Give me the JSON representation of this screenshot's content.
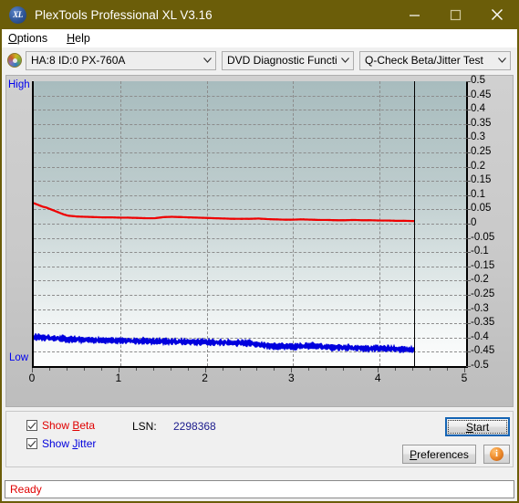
{
  "window": {
    "title": "PlexTools Professional XL V3.16",
    "icon": "xl-logo-icon",
    "minimize_label": "minimize-icon",
    "maximize_label": "maximize-icon",
    "close_label": "close-icon",
    "titlebar_color": "#6b5d09"
  },
  "menu": [
    {
      "label": "Options",
      "mnemonic": "O"
    },
    {
      "label": "Help",
      "mnemonic": "H"
    }
  ],
  "toolbar": {
    "drive_icon": "disc-icon",
    "drive_combo": {
      "value": "HA:8 ID:0  PX-760A"
    },
    "function_combo": {
      "value": "DVD Diagnostic Functions"
    },
    "test_combo": {
      "value": "Q-Check Beta/Jitter Test"
    }
  },
  "chart_data": {
    "type": "line",
    "title": "",
    "xlabel": "",
    "ylabel": "",
    "xlim": [
      0,
      5
    ],
    "ylim": [
      -0.5,
      0.5
    ],
    "grid": true,
    "legend": "below-chart",
    "axis_left_label": "High",
    "axis_bottom_left_label": "Low",
    "xticks": [
      0,
      1,
      2,
      3,
      4,
      5
    ],
    "yticks": [
      0.5,
      0.45,
      0.4,
      0.35,
      0.3,
      0.25,
      0.2,
      0.15,
      0.1,
      0.05,
      0,
      -0.05,
      -0.1,
      -0.15,
      -0.2,
      -0.25,
      -0.3,
      -0.35,
      -0.4,
      -0.45,
      -0.5
    ],
    "ytick_labels": [
      "0.5",
      "0.45",
      "0.4",
      "0.35",
      "0.3",
      "0.25",
      "0.2",
      "0.15",
      "0.1",
      "0.05",
      "0",
      "-0.05",
      "-0.1",
      "-0.15",
      "-0.2",
      "-0.25",
      "-0.3",
      "-0.35",
      "-0.4",
      "-0.45",
      "-0.5"
    ],
    "data_end_x": 4.4,
    "marker_line_x": 4.4,
    "series": [
      {
        "name": "Beta",
        "color": "#ee0000",
        "x": [
          0.0,
          0.05,
          0.1,
          0.15,
          0.2,
          0.25,
          0.3,
          0.35,
          0.4,
          0.5,
          0.6,
          0.7,
          0.8,
          0.9,
          1.0,
          1.1,
          1.2,
          1.3,
          1.4,
          1.5,
          1.6,
          1.7,
          1.8,
          1.9,
          2.0,
          2.1,
          2.2,
          2.3,
          2.4,
          2.5,
          2.6,
          2.7,
          2.8,
          2.9,
          3.0,
          3.1,
          3.2,
          3.3,
          3.4,
          3.5,
          3.6,
          3.7,
          3.8,
          3.9,
          4.0,
          4.1,
          4.2,
          4.3,
          4.4
        ],
        "y": [
          0.072,
          0.066,
          0.06,
          0.056,
          0.05,
          0.044,
          0.038,
          0.032,
          0.028,
          0.025,
          0.024,
          0.023,
          0.022,
          0.022,
          0.021,
          0.021,
          0.02,
          0.019,
          0.019,
          0.023,
          0.024,
          0.023,
          0.022,
          0.021,
          0.02,
          0.019,
          0.018,
          0.017,
          0.017,
          0.017,
          0.018,
          0.016,
          0.015,
          0.014,
          0.014,
          0.015,
          0.014,
          0.013,
          0.013,
          0.012,
          0.012,
          0.013,
          0.012,
          0.012,
          0.011,
          0.011,
          0.01,
          0.01,
          0.009
        ]
      },
      {
        "name": "Jitter",
        "color": "#0000dd",
        "x": [
          0.0,
          0.1,
          0.2,
          0.3,
          0.4,
          0.5,
          0.6,
          0.7,
          0.8,
          0.9,
          1.0,
          1.1,
          1.2,
          1.3,
          1.4,
          1.5,
          1.6,
          1.7,
          1.8,
          1.9,
          2.0,
          2.1,
          2.2,
          2.3,
          2.4,
          2.5,
          2.6,
          2.7,
          2.8,
          2.9,
          3.0,
          3.1,
          3.2,
          3.3,
          3.4,
          3.5,
          3.6,
          3.7,
          3.8,
          3.9,
          4.0,
          4.1,
          4.2,
          4.3,
          4.4
        ],
        "y": [
          -0.398,
          -0.4,
          -0.401,
          -0.404,
          -0.406,
          -0.407,
          -0.408,
          -0.409,
          -0.41,
          -0.41,
          -0.411,
          -0.411,
          -0.412,
          -0.412,
          -0.413,
          -0.413,
          -0.414,
          -0.414,
          -0.415,
          -0.415,
          -0.416,
          -0.417,
          -0.417,
          -0.418,
          -0.419,
          -0.42,
          -0.424,
          -0.428,
          -0.43,
          -0.431,
          -0.432,
          -0.43,
          -0.429,
          -0.431,
          -0.433,
          -0.434,
          -0.435,
          -0.436,
          -0.437,
          -0.438,
          -0.438,
          -0.439,
          -0.44,
          -0.441,
          -0.442
        ],
        "noise_band": 0.018,
        "note": "dense noisy band"
      }
    ]
  },
  "controls": {
    "show_beta": {
      "label": "Show Beta",
      "mnemonic": "B",
      "checked": true,
      "color": "#e00000"
    },
    "show_jitter": {
      "label": "Show Jitter",
      "mnemonic": "J",
      "checked": true,
      "color": "#0000dd"
    },
    "lsn_label": "LSN:",
    "lsn_value": "2298368",
    "start_button": "Start",
    "preferences_button": "Preferences",
    "info_button": "i"
  },
  "statusbar": {
    "text": "Ready",
    "color": "#e00000"
  }
}
